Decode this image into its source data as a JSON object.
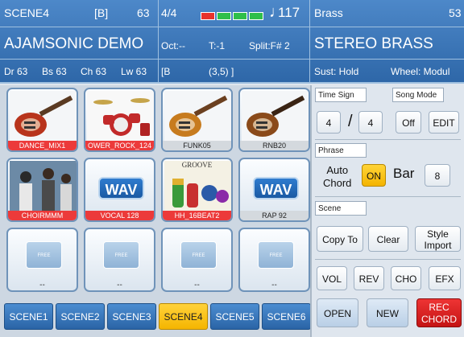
{
  "header_left": {
    "scene_name": "SCENE4",
    "bank": "[B]",
    "scene_value": "63",
    "style_name": "AJAMSONIC DEMO",
    "mixer": [
      "Dr 63",
      "Bs 63",
      "Ch 63",
      "Lw 63"
    ]
  },
  "header_mid": {
    "time_sig": "4/4",
    "tempo_note": "♩",
    "tempo": "117",
    "octave": "Oct:--",
    "transpose": "T:-1",
    "split": "Split:F# 2",
    "position_bank": "[B",
    "position": "(3,5) ]",
    "beat_colors": [
      "#e8322c",
      "#2fbf4a",
      "#2fbf4a",
      "#2fbf4a"
    ]
  },
  "header_right": {
    "category": "Brass",
    "value": "53",
    "voice_name": "STEREO BRASS",
    "sustain": "Sust: Hold",
    "wheel": "Wheel: Modul"
  },
  "pads": [
    {
      "label": "DANCE_MIX1",
      "style": "red",
      "icon": "electric-guitar-icon"
    },
    {
      "label": "OWER_ROCK_124",
      "style": "red",
      "icon": "drum-kit-icon"
    },
    {
      "label": "FUNK05",
      "style": "grey",
      "icon": "electric-guitar-icon"
    },
    {
      "label": "RNB20",
      "style": "grey",
      "icon": "bass-guitar-icon"
    },
    {
      "label": "CHOIRMMM",
      "style": "red",
      "icon": "choir-photo-icon"
    },
    {
      "label": "VOCAL 128",
      "style": "red",
      "icon": "wav-icon",
      "badge": "WAV"
    },
    {
      "label": "HH_16BEAT2",
      "style": "red",
      "icon": "groove-icon",
      "badge": "GROOVE"
    },
    {
      "label": "RAP 92",
      "style": "grey",
      "icon": "wav-icon",
      "badge": "WAV"
    },
    {
      "label": "--",
      "style": "empty",
      "icon": "free-icon",
      "badge": "FREE"
    },
    {
      "label": "--",
      "style": "empty",
      "icon": "free-icon",
      "badge": "FREE"
    },
    {
      "label": "--",
      "style": "empty",
      "icon": "free-icon",
      "badge": "FREE"
    },
    {
      "label": "--",
      "style": "empty",
      "icon": "free-icon",
      "badge": "FREE"
    }
  ],
  "scenes": [
    "SCENE1",
    "SCENE2",
    "SCENE3",
    "SCENE4",
    "SCENE5",
    "SCENE6"
  ],
  "active_scene": "SCENE4",
  "panel": {
    "time_sign_label": "Time Sign",
    "ts_num": "4",
    "ts_slash": "/",
    "ts_den": "4",
    "song_mode_label": "Song Mode",
    "song_mode_off": "Off",
    "song_mode_edit": "EDIT",
    "phrase_label": "Phrase",
    "auto_chord": "Auto\nChord",
    "on": "ON",
    "bar": "Bar",
    "bar_value": "8",
    "scene_label": "Scene",
    "copy_to": "Copy To",
    "clear": "Clear",
    "style_import": "Style\nImport",
    "vol": "VOL",
    "rev": "REV",
    "cho": "CHO",
    "efx": "EFX",
    "open": "OPEN",
    "new": "NEW",
    "rec_chord": "REC\nCHORD"
  }
}
